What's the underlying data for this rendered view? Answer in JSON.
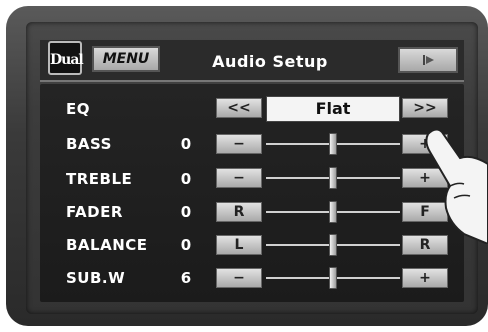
{
  "header": {
    "logo_text": "Dual",
    "menu_label": "MENU",
    "title": "Audio Setup",
    "back_icon": "back-icon"
  },
  "eq": {
    "label": "EQ",
    "prev_label": "<<",
    "value": "Flat",
    "next_label": ">>"
  },
  "rows": [
    {
      "label": "BASS",
      "value": "0",
      "left_label": "−",
      "right_label": "+",
      "level": 0.5
    },
    {
      "label": "TREBLE",
      "value": "0",
      "left_label": "−",
      "right_label": "+",
      "level": 0.5
    },
    {
      "label": "FADER",
      "value": "0",
      "left_label": "R",
      "right_label": "F",
      "level": 0.5
    },
    {
      "label": "BALANCE",
      "value": "0",
      "left_label": "L",
      "right_label": "R",
      "level": 0.5
    },
    {
      "label": "SUB.W",
      "value": "6",
      "left_label": "−",
      "right_label": "+",
      "level": 0.5
    }
  ],
  "colors": {
    "screen_bg": "#3c3c3c",
    "panel_bg": "#1f1f1f",
    "button_face": "#d0d0d0",
    "text": "#ffffff"
  }
}
